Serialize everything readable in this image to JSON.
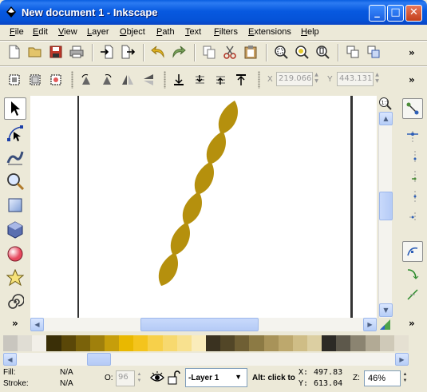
{
  "window": {
    "title": "New document 1 - Inkscape",
    "minimize_glyph": "_",
    "maximize_glyph": "□",
    "close_glyph": "✕"
  },
  "menu": [
    "File",
    "Edit",
    "View",
    "Layer",
    "Object",
    "Path",
    "Text",
    "Filters",
    "Extensions",
    "Help"
  ],
  "toolbar_overflow": "»",
  "selection_bar": {
    "x_label": "X",
    "x_value": "219.066",
    "y_label": "Y",
    "y_value": "443.131"
  },
  "status": {
    "fill_label": "Fill:",
    "fill_value": "N/A",
    "stroke_label": "Stroke:",
    "stroke_value": "N/A",
    "opacity_label": "O:",
    "opacity_value": "96",
    "layer_value": "-Layer 1",
    "message": "Alt: click to",
    "x_label": "X:",
    "x_value": "497.83",
    "y_label": "Y:",
    "y_value": "613.04",
    "zoom_label": "Z:",
    "zoom_value": "46%"
  },
  "colors": {
    "leaf": "#b5900d",
    "accent": "#0a5fe0"
  },
  "palette": [
    "#c9c6bf",
    "#e0ddd4",
    "#f2efe8",
    "#3a2f07",
    "#5a4708",
    "#7a620a",
    "#a0800c",
    "#c69e0b",
    "#e9b800",
    "#f4c41d",
    "#f7d04a",
    "#f7d96f",
    "#f8e18f",
    "#faecbb",
    "#3a3220",
    "#524627",
    "#6f5f34",
    "#8c7a44",
    "#a89359",
    "#bda86d",
    "#cfbd86",
    "#dccfa2",
    "#2c2a25",
    "#5d584b",
    "#8b8471",
    "#b2aa95",
    "#cfc9b8",
    "#e5e0d2"
  ]
}
